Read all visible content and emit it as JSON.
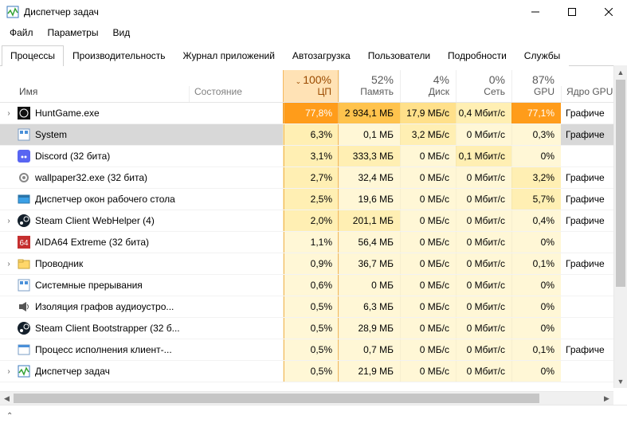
{
  "window": {
    "title": "Диспетчер задач"
  },
  "menu": {
    "file": "Файл",
    "options": "Параметры",
    "view": "Вид"
  },
  "tabs": {
    "processes": "Процессы",
    "performance": "Производительность",
    "apphistory": "Журнал приложений",
    "startup": "Автозагрузка",
    "users": "Пользователи",
    "details": "Подробности",
    "services": "Службы"
  },
  "headers": {
    "name": "Имя",
    "status": "Состояние",
    "cpu_pct": "100%",
    "cpu_lbl": "ЦП",
    "mem_pct": "52%",
    "mem_lbl": "Память",
    "disk_pct": "4%",
    "disk_lbl": "Диск",
    "net_pct": "0%",
    "net_lbl": "Сеть",
    "gpu_pct": "87%",
    "gpu_lbl": "GPU",
    "gpucore": "Ядро GPU"
  },
  "rows": [
    {
      "expand": true,
      "icon": "hunt",
      "name": "HuntGame.exe",
      "cpu": "77,8%",
      "mem": "2 934,1 МБ",
      "disk": "17,9 МБ/с",
      "net": "0,4 Мбит/с",
      "gpu": "77,1%",
      "gpucore": "Графиче",
      "h": {
        "cpu": 5,
        "mem": 4,
        "disk": 3,
        "net": 2,
        "gpu": 5
      }
    },
    {
      "expand": false,
      "icon": "system",
      "name": "System",
      "cpu": "6,3%",
      "mem": "0,1 МБ",
      "disk": "3,2 МБ/с",
      "net": "0 Мбит/с",
      "gpu": "0,3%",
      "gpucore": "Графиче",
      "selected": true,
      "h": {
        "cpu": 2,
        "mem": 1,
        "disk": 2,
        "net": 1,
        "gpu": 1
      }
    },
    {
      "expand": false,
      "icon": "discord",
      "name": "Discord (32 бита)",
      "cpu": "3,1%",
      "mem": "333,3 МБ",
      "disk": "0 МБ/с",
      "net": "0,1 Мбит/с",
      "gpu": "0%",
      "gpucore": "",
      "h": {
        "cpu": 2,
        "mem": 2,
        "disk": 1,
        "net": 2,
        "gpu": 1
      }
    },
    {
      "expand": false,
      "icon": "gear",
      "name": "wallpaper32.exe (32 бита)",
      "cpu": "2,7%",
      "mem": "32,4 МБ",
      "disk": "0 МБ/с",
      "net": "0 Мбит/с",
      "gpu": "3,2%",
      "gpucore": "Графиче",
      "h": {
        "cpu": 2,
        "mem": 1,
        "disk": 1,
        "net": 1,
        "gpu": 2
      }
    },
    {
      "expand": false,
      "icon": "dwm",
      "name": "Диспетчер окон рабочего стола",
      "cpu": "2,5%",
      "mem": "19,6 МБ",
      "disk": "0 МБ/с",
      "net": "0 Мбит/с",
      "gpu": "5,7%",
      "gpucore": "Графиче",
      "h": {
        "cpu": 2,
        "mem": 1,
        "disk": 1,
        "net": 1,
        "gpu": 2
      }
    },
    {
      "expand": true,
      "icon": "steam",
      "name": "Steam Client WebHelper (4)",
      "cpu": "2,0%",
      "mem": "201,1 МБ",
      "disk": "0 МБ/с",
      "net": "0 Мбит/с",
      "gpu": "0,4%",
      "gpucore": "Графиче",
      "h": {
        "cpu": 2,
        "mem": 2,
        "disk": 1,
        "net": 1,
        "gpu": 1
      }
    },
    {
      "expand": false,
      "icon": "aida",
      "name": "AIDA64 Extreme (32 бита)",
      "cpu": "1,1%",
      "mem": "56,4 МБ",
      "disk": "0 МБ/с",
      "net": "0 Мбит/с",
      "gpu": "0%",
      "gpucore": "",
      "h": {
        "cpu": 1,
        "mem": 1,
        "disk": 1,
        "net": 1,
        "gpu": 1
      }
    },
    {
      "expand": true,
      "icon": "explorer",
      "name": "Проводник",
      "cpu": "0,9%",
      "mem": "36,7 МБ",
      "disk": "0 МБ/с",
      "net": "0 Мбит/с",
      "gpu": "0,1%",
      "gpucore": "Графиче",
      "h": {
        "cpu": 1,
        "mem": 1,
        "disk": 1,
        "net": 1,
        "gpu": 1
      }
    },
    {
      "expand": false,
      "icon": "system",
      "name": "Системные прерывания",
      "cpu": "0,6%",
      "mem": "0 МБ",
      "disk": "0 МБ/с",
      "net": "0 Мбит/с",
      "gpu": "0%",
      "gpucore": "",
      "h": {
        "cpu": 1,
        "mem": 1,
        "disk": 1,
        "net": 1,
        "gpu": 1
      }
    },
    {
      "expand": false,
      "icon": "audio",
      "name": "Изоляция графов аудиоустро...",
      "cpu": "0,5%",
      "mem": "6,3 МБ",
      "disk": "0 МБ/с",
      "net": "0 Мбит/с",
      "gpu": "0%",
      "gpucore": "",
      "h": {
        "cpu": 1,
        "mem": 1,
        "disk": 1,
        "net": 1,
        "gpu": 1
      }
    },
    {
      "expand": false,
      "icon": "steam",
      "name": "Steam Client Bootstrapper (32 б...",
      "cpu": "0,5%",
      "mem": "28,9 МБ",
      "disk": "0 МБ/с",
      "net": "0 Мбит/с",
      "gpu": "0%",
      "gpucore": "",
      "h": {
        "cpu": 1,
        "mem": 1,
        "disk": 1,
        "net": 1,
        "gpu": 1
      }
    },
    {
      "expand": false,
      "icon": "cse",
      "name": "Процесс исполнения клиент-...",
      "cpu": "0,5%",
      "mem": "0,7 МБ",
      "disk": "0 МБ/с",
      "net": "0 Мбит/с",
      "gpu": "0,1%",
      "gpucore": "Графиче",
      "h": {
        "cpu": 1,
        "mem": 1,
        "disk": 1,
        "net": 1,
        "gpu": 1
      }
    },
    {
      "expand": true,
      "icon": "taskmgr",
      "name": "Диспетчер задач",
      "cpu": "0,5%",
      "mem": "21,9 МБ",
      "disk": "0 МБ/с",
      "net": "0 Мбит/с",
      "gpu": "0%",
      "gpucore": "",
      "h": {
        "cpu": 1,
        "mem": 1,
        "disk": 1,
        "net": 1,
        "gpu": 1
      }
    }
  ]
}
